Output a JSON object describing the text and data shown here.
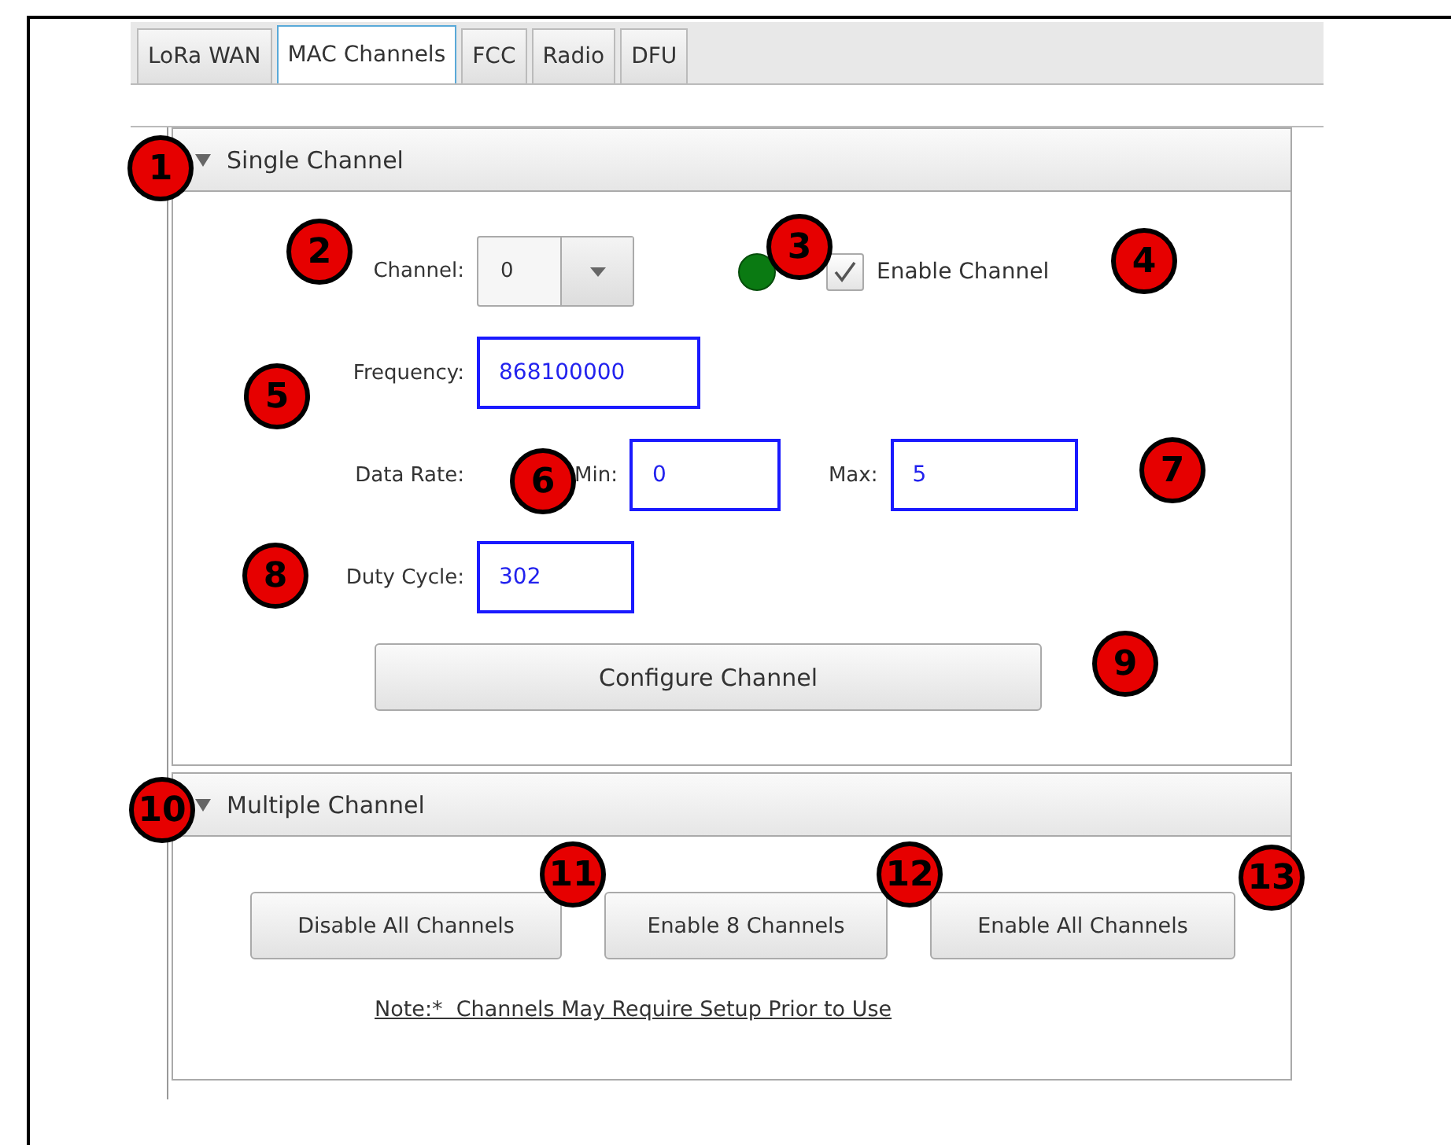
{
  "tabs": [
    {
      "label": "LoRa WAN",
      "selected": false
    },
    {
      "label": "MAC Channels",
      "selected": true
    },
    {
      "label": "FCC",
      "selected": false
    },
    {
      "label": "Radio",
      "selected": false
    },
    {
      "label": "DFU",
      "selected": false
    }
  ],
  "single_channel": {
    "title": "Single Channel",
    "expanded": true,
    "channel": {
      "label": "Channel:",
      "value": "0"
    },
    "status_on": true,
    "enable": {
      "label": "Enable Channel",
      "checked": true
    },
    "frequency": {
      "label": "Frequency:",
      "value": "868100000"
    },
    "data_rate": {
      "label": "Data Rate:",
      "min_label": "Min:",
      "min": "0",
      "max_label": "Max:",
      "max": "5"
    },
    "duty_cycle": {
      "label": "Duty Cycle:",
      "value": "302"
    },
    "button": "Configure Channel"
  },
  "multiple_channel": {
    "title": "Multiple Channel",
    "expanded": true,
    "buttons": [
      "Disable All Channels",
      "Enable 8 Channels",
      "Enable All Channels"
    ],
    "note": "Note:*  Channels May Require Setup Prior to Use"
  },
  "callouts": [
    "1",
    "2",
    "3",
    "4",
    "5",
    "6",
    "7",
    "8",
    "9",
    "10",
    "11",
    "12",
    "13"
  ]
}
